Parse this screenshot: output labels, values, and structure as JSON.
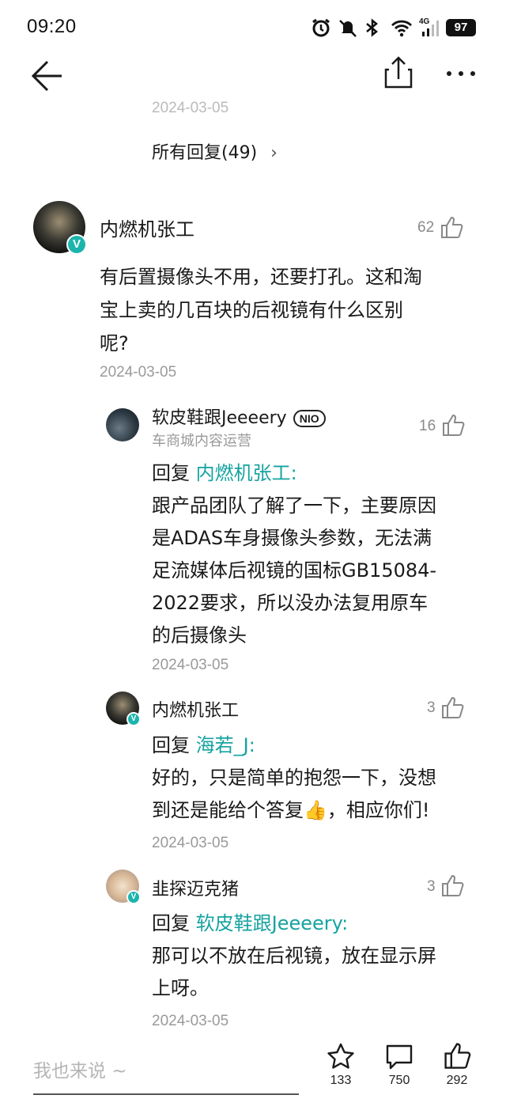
{
  "status_bar": {
    "time": "09:20",
    "battery": "97",
    "network": "4G"
  },
  "header": {
    "back_icon": "arrow-left-icon",
    "share_icon": "share-icon",
    "more_icon": "more-icon"
  },
  "top": {
    "partial_date": "2024-03-05",
    "all_replies": "所有回复(49)",
    "all_replies_chevron": "›"
  },
  "comment": {
    "author": "内燃机张工",
    "likes": "62",
    "text_lines": [
      "有后置摄像头不用，还要打孔。这和淘",
      "宝上卖的几百块的后视镜有什么区别",
      "呢?"
    ],
    "date": "2024-03-05",
    "verified_badge": "V"
  },
  "replies": [
    {
      "author": "软皮鞋跟Jeeeery",
      "badge": "NIO",
      "subtitle": "车商城内容运营",
      "likes": "16",
      "reply_prefix": "回复",
      "reply_to": "内燃机张工:",
      "text_lines": [
        "跟产品团队了解了一下，主要原因",
        "是ADAS车身摄像头参数，无法满",
        "足流媒体后视镜的国标GB15084-",
        "2022要求，所以没办法复用原车",
        "的后摄像头"
      ],
      "date": "2024-03-05"
    },
    {
      "author": "内燃机张工",
      "likes": "3",
      "reply_prefix": "回复",
      "reply_to": "海若_J:",
      "text_lines": [
        "好的，只是简单的抱怨一下，没想",
        "到还是能给个答复👍，相应你们!"
      ],
      "date": "2024-03-05"
    },
    {
      "author": "韭探迈克猪",
      "likes": "3",
      "reply_prefix": "回复",
      "reply_to": "软皮鞋跟Jeeeery:",
      "text_lines": [
        "那可以不放在后视镜，放在显示屏",
        "上呀。"
      ],
      "date": "2024-03-05"
    }
  ],
  "bottom_bar": {
    "input_placeholder": "我也来说 ~",
    "star_count": "133",
    "comment_count": "750",
    "like_count": "292"
  },
  "colors": {
    "accent_teal": "#16a3a0",
    "verified_badge": "#1cb5ad",
    "date_gray": "#9a9a9a"
  }
}
